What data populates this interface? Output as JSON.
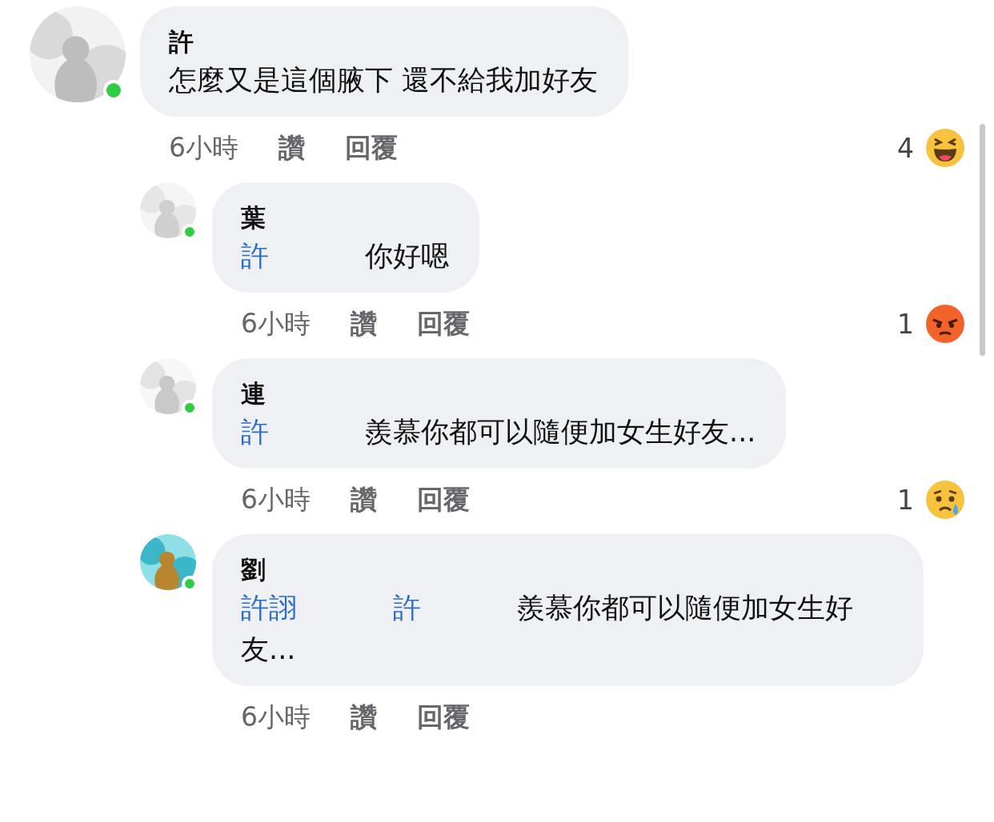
{
  "comments": [
    {
      "author": "許",
      "text": "怎麼又是這個腋下 還不給我加好友",
      "time": "6小時",
      "like": "讚",
      "reply": "回覆",
      "online": true,
      "reaction": {
        "count": "4",
        "kind": "haha"
      },
      "children": [
        {
          "author": "葉",
          "mentions": [
            "許"
          ],
          "text": "你好嗯",
          "time": "6小時",
          "like": "讚",
          "reply": "回覆",
          "online": true,
          "reaction": {
            "count": "1",
            "kind": "angry"
          }
        },
        {
          "author": "連",
          "mentions": [
            "許"
          ],
          "text": "羨慕你都可以隨便加女生好友...",
          "time": "6小時",
          "like": "讚",
          "reply": "回覆",
          "online": true,
          "reaction": {
            "count": "1",
            "kind": "sad"
          }
        },
        {
          "author": "劉",
          "mentions": [
            "許詡",
            "許"
          ],
          "text": "羨慕你都可以隨便加女生好友...",
          "time": "6小時",
          "like": "讚",
          "reply": "回覆",
          "online": true
        }
      ]
    }
  ]
}
